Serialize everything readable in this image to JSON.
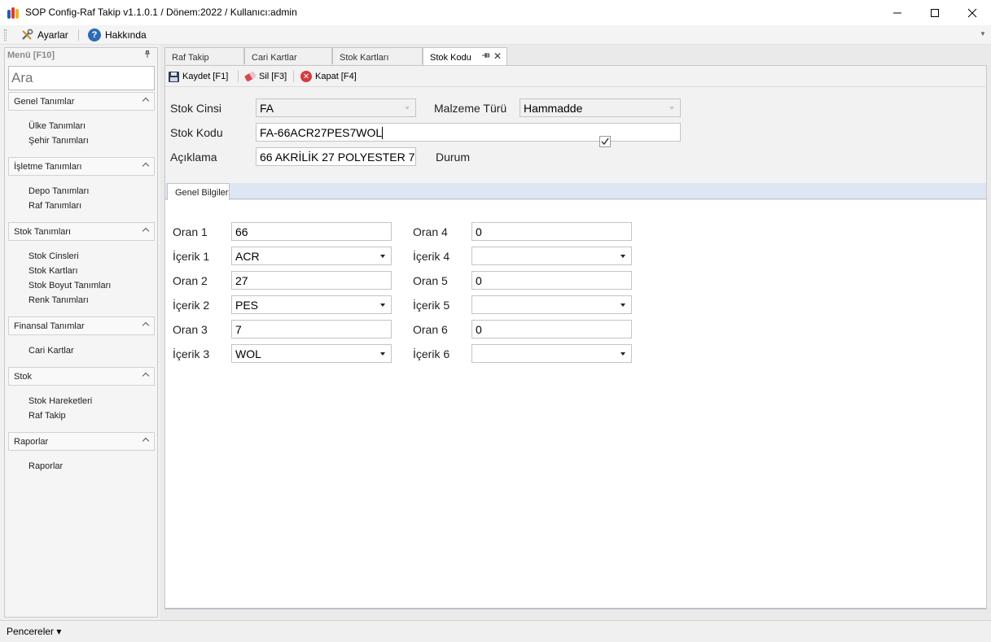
{
  "window": {
    "title": "SOP Config-Raf Takip v1.1.0.1 / Dönem:2022 / Kullanıcı:admin",
    "logo_colors": [
      "#1f5fbf",
      "#e03b2f",
      "#f2b021"
    ]
  },
  "menubar": {
    "ayarlar": "Ayarlar",
    "hakkinda": "Hakkında",
    "help_icon_glyph": "?"
  },
  "sidebar": {
    "header": "Menü [F10]",
    "search_placeholder": "Ara",
    "groups": [
      {
        "label": "Genel Tanımlar",
        "items": [
          "Ülke Tanımları",
          "Şehir Tanımları"
        ]
      },
      {
        "label": "İşletme Tanımları",
        "items": [
          "Depo Tanımları",
          "Raf Tanımları"
        ]
      },
      {
        "label": "Stok Tanımları",
        "items": [
          "Stok Cinsleri",
          "Stok Kartları",
          "Stok Boyut Tanımları",
          "Renk Tanımları"
        ]
      },
      {
        "label": "Finansal Tanımlar",
        "items": [
          "Cari Kartlar"
        ]
      },
      {
        "label": "Stok",
        "items": [
          "Stok Hareketleri",
          "Raf Takip"
        ]
      },
      {
        "label": "Raporlar",
        "items": [
          "Raporlar"
        ]
      }
    ]
  },
  "tabs": [
    {
      "label": "Raf Takip",
      "active": false
    },
    {
      "label": "Cari Kartlar",
      "active": false
    },
    {
      "label": "Stok Kartları",
      "active": false
    },
    {
      "label": "Stok Kodu",
      "active": true
    }
  ],
  "toolbar": {
    "kaydet": "Kaydet [F1]",
    "sil": "Sil [F3]",
    "kapat": "Kapat [F4]"
  },
  "form": {
    "stok_cinsi_label": "Stok Cinsi",
    "stok_cinsi_value": "FA",
    "malzeme_turu_label": "Malzeme Türü",
    "malzeme_turu_value": "Hammadde",
    "stok_kodu_label": "Stok Kodu",
    "stok_kodu_value": "FA-66ACR27PES7WOL",
    "aciklama_label": "Açıklama",
    "aciklama_value": "66 AKRİLİK 27 POLYESTER 7",
    "durum_label": "Durum",
    "durum_checked": true
  },
  "genel_bilgiler": {
    "tab_label": "Genel Bilgiler",
    "left": [
      {
        "label": "Oran 1",
        "value": "66",
        "type": "text"
      },
      {
        "label": "İçerik 1",
        "value": "ACR",
        "type": "combo"
      },
      {
        "label": "Oran 2",
        "value": "27",
        "type": "text"
      },
      {
        "label": "İçerik 2",
        "value": "PES",
        "type": "combo"
      },
      {
        "label": "Oran 3",
        "value": "7",
        "type": "text"
      },
      {
        "label": "İçerik 3",
        "value": "WOL",
        "type": "combo"
      }
    ],
    "right": [
      {
        "label": "Oran 4",
        "value": "0",
        "type": "text"
      },
      {
        "label": "İçerik 4",
        "value": "",
        "type": "combo"
      },
      {
        "label": "Oran 5",
        "value": "0",
        "type": "text"
      },
      {
        "label": "İçerik 5",
        "value": "",
        "type": "combo"
      },
      {
        "label": "Oran 6",
        "value": "0",
        "type": "text"
      },
      {
        "label": "İçerik 6",
        "value": "",
        "type": "combo"
      }
    ]
  },
  "statusbar": {
    "pencereler": "Pencereler ▾"
  }
}
